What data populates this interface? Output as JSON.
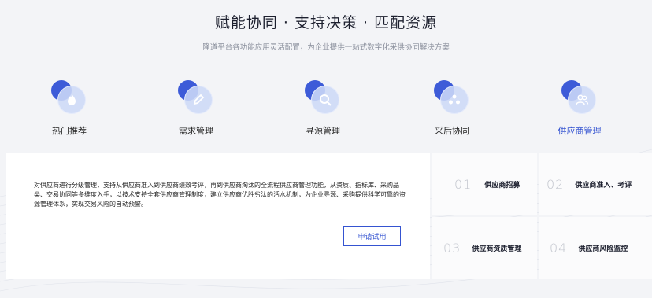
{
  "header": {
    "title": "赋能协同 · 支持决策 · 匹配资源",
    "subtitle": "隆道平台各功能应用灵活配置，为企业提供一站式数字化采供协同解决方案"
  },
  "tabs": [
    {
      "label": "热门推荐",
      "icon": "flame-icon",
      "active": false
    },
    {
      "label": "需求管理",
      "icon": "pencil-icon",
      "active": false
    },
    {
      "label": "寻源管理",
      "icon": "search-icon",
      "active": false
    },
    {
      "label": "采后协同",
      "icon": "collaboration-icon",
      "active": false
    },
    {
      "label": "供应商管理",
      "icon": "users-icon",
      "active": true
    }
  ],
  "panel": {
    "description": "对供应商进行分级管理，支持从供应商准入到供应商绩效考评，再到供应商淘汰的全流程供应商管理功能，从资质、指标库、采购品类、交易协同等多维度入手，以技术支持全套供应商管理制度，建立供应商优胜劣汰的活水机制，为企业寻源、采购提供科学可靠的资源管理体系，实现交易风险的自动预警。",
    "apply_label": "申请试用"
  },
  "features": [
    {
      "num": "01",
      "label": "供应商招募"
    },
    {
      "num": "02",
      "label": "供应商准入、考评"
    },
    {
      "num": "03",
      "label": "供应商资质管理"
    },
    {
      "num": "04",
      "label": "供应商风险监控"
    }
  ],
  "colors": {
    "accent": "#3554d1",
    "icon_dot": "#3d5bd8",
    "icon_ring": "#cdd9f7",
    "page_bg": "#f3f4f7"
  }
}
